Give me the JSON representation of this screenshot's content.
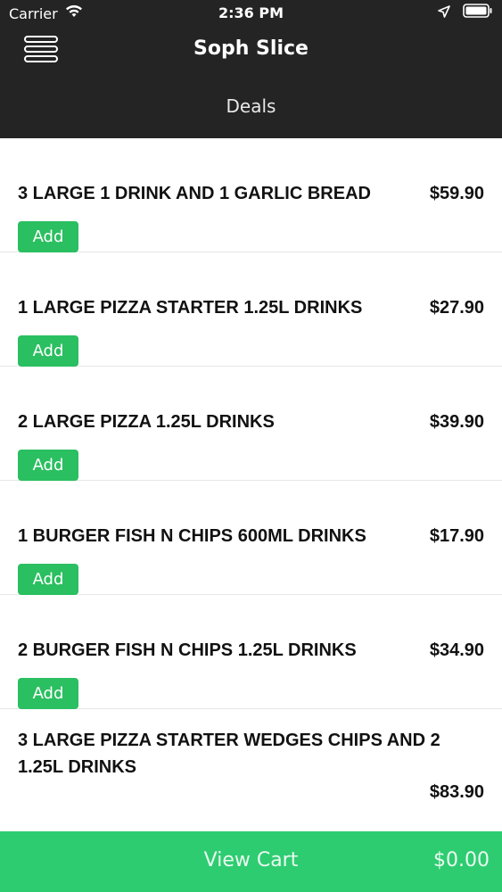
{
  "status_bar": {
    "carrier": "Carrier",
    "time": "2:36 PM"
  },
  "nav": {
    "title": "Soph Slice",
    "subtitle": "Deals"
  },
  "deals": [
    {
      "title": "3 LARGE 1 DRINK AND 1 GARLIC BREAD",
      "price": "$59.90",
      "button_label": "Add"
    },
    {
      "title": "1 LARGE PIZZA STARTER 1.25L DRINKS",
      "price": "$27.90",
      "button_label": "Add"
    },
    {
      "title": "2 LARGE PIZZA 1.25L DRINKS",
      "price": "$39.90",
      "button_label": "Add"
    },
    {
      "title": "1 BURGER FISH N CHIPS 600ML DRINKS",
      "price": "$17.90",
      "button_label": "Add"
    },
    {
      "title": "2 BURGER FISH N CHIPS 1.25L DRINKS",
      "price": "$34.90",
      "button_label": "Add"
    },
    {
      "title": "3 LARGE PIZZA STARTER WEDGES CHIPS AND 2 1.25L DRINKS",
      "price": "$83.90"
    }
  ],
  "cart": {
    "label": "View Cart",
    "total": "$0.00"
  },
  "icons": {
    "menu": "hamburger-menu-icon",
    "wifi": "wifi-icon",
    "location": "location-arrow-icon",
    "battery": "battery-icon"
  },
  "colors": {
    "header_bg": "#242424",
    "accent_green": "#2abf60",
    "cart_green": "#2ecc71"
  }
}
